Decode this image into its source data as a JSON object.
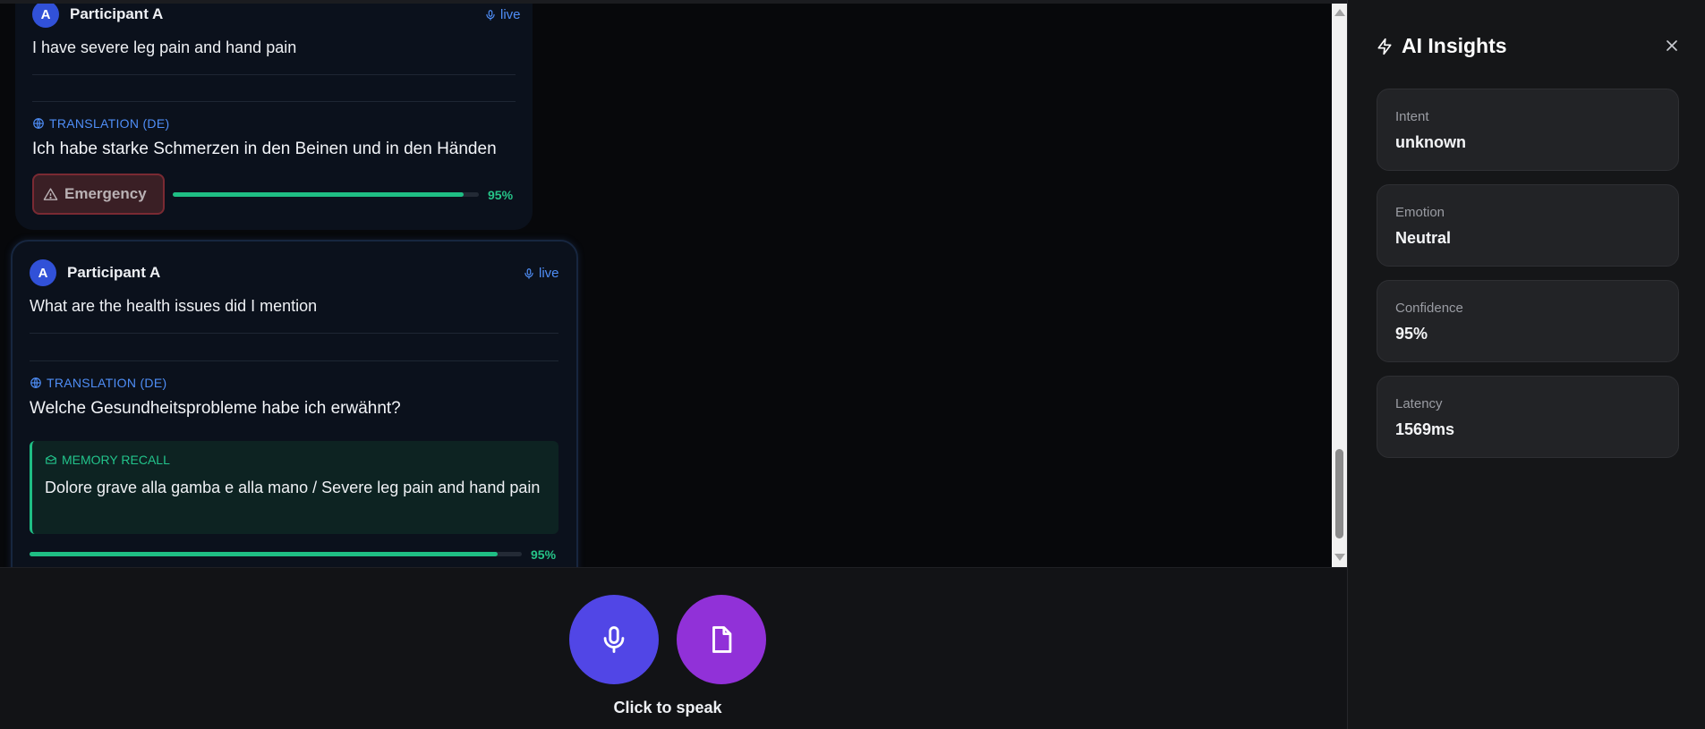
{
  "transcript": {
    "messages": [
      {
        "avatar": "A",
        "speaker": "Participant A",
        "status": "live",
        "text": "I have severe leg pain and hand pain",
        "translation_label": "TRANSLATION (DE)",
        "translation": "Ich habe starke Schmerzen in den Beinen und in den Händen",
        "badge": "Emergency",
        "confidence": 0.95,
        "confidence_label": "95%"
      },
      {
        "avatar": "A",
        "speaker": "Participant A",
        "status": "live",
        "text": "What are the health issues did I mention",
        "translation_label": "TRANSLATION (DE)",
        "translation": "Welche Gesundheitsprobleme habe ich erwähnt?",
        "memory_label": "MEMORY RECALL",
        "memory_text": "Dolore grave alla gamba e alla mano / Severe leg pain and hand pain",
        "confidence": 0.95,
        "confidence_label": "95%"
      }
    ]
  },
  "controls": {
    "speak_label": "Click to speak"
  },
  "insights": {
    "title": "AI Insights",
    "stats": [
      {
        "label": "Intent",
        "value": "unknown"
      },
      {
        "label": "Emotion",
        "value": "Neutral"
      },
      {
        "label": "Confidence",
        "value": "95%"
      },
      {
        "label": "Latency",
        "value": "1569ms"
      }
    ]
  },
  "colors": {
    "accent_blue": "#4f8ef7",
    "mic_button": "#5146e6",
    "doc_button": "#9131d8",
    "success": "#1fbe84",
    "emergency_bg": "#3a1f25"
  },
  "icons": {
    "live": "microphone-icon",
    "translation": "globe-icon",
    "emergency": "warning-triangle-icon",
    "memory": "archive-icon",
    "mic": "microphone-icon",
    "document": "document-icon",
    "insights": "lightning-icon",
    "close": "close-icon"
  }
}
